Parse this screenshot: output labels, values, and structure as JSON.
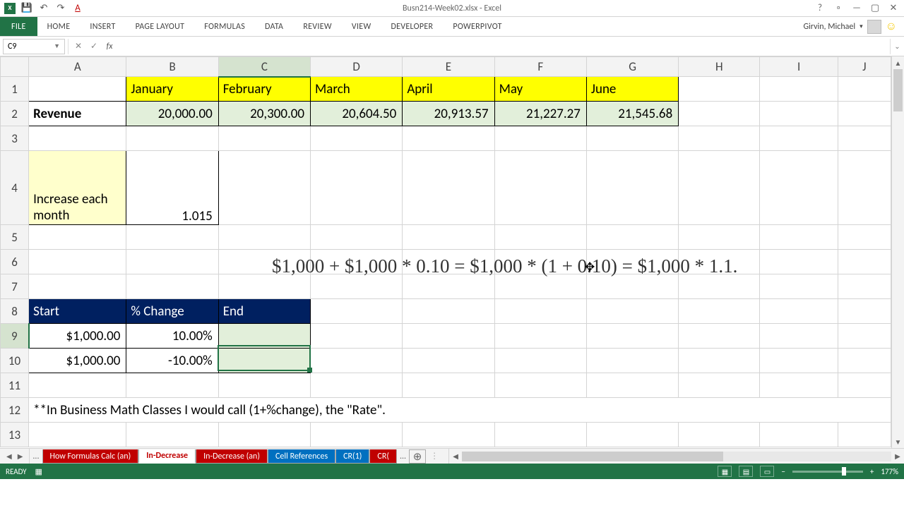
{
  "titlebar": {
    "filename": "Busn214-Week02.xlsx - Excel",
    "qat_icons": [
      "excel",
      "save",
      "undo",
      "redo",
      "font-color"
    ]
  },
  "ribbon": {
    "tabs": [
      "FILE",
      "HOME",
      "INSERT",
      "PAGE LAYOUT",
      "FORMULAS",
      "DATA",
      "REVIEW",
      "VIEW",
      "DEVELOPER",
      "POWERPIVOT"
    ],
    "user": "Girvin, Michael"
  },
  "namebox": {
    "value": "C9"
  },
  "formulabar": {
    "value": ""
  },
  "columns": [
    "A",
    "B",
    "C",
    "D",
    "E",
    "F",
    "G",
    "H",
    "I",
    "J"
  ],
  "active_col": "C",
  "active_row": "9",
  "rows_visible": [
    "1",
    "2",
    "3",
    "4",
    "5",
    "6",
    "7",
    "8",
    "9",
    "10",
    "11",
    "12",
    "13"
  ],
  "cells": {
    "A2": "Revenue",
    "B1": "January",
    "C1": "February",
    "D1": "March",
    "E1": "April",
    "F1": "May",
    "G1": "June",
    "B2": "20,000.00",
    "C2": "20,300.00",
    "D2": "20,604.50",
    "E2": "20,913.57",
    "F2": "21,227.27",
    "G2": "21,545.68",
    "A4": "Increase each month",
    "B4": "1.015",
    "A8": "Start",
    "B8": "% Change",
    "C8": "End",
    "A9": "$1,000.00",
    "B9": "10.00%",
    "A10": "$1,000.00",
    "B10": "-10.00%",
    "A12": "**In Business Math Classes I would call (1+%change), the \"Rate\"."
  },
  "floating_formula": "$1,000 + $1,000 * 0.10 = $1,000 * (1 + 0.10) = $1,000 * 1.1.",
  "sheet_tabs": {
    "nav_dots": "...",
    "tabs": [
      {
        "label": "How Formulas Calc (an)",
        "style": "red"
      },
      {
        "label": "In-Decrease",
        "style": "active"
      },
      {
        "label": "In-Decrease (an)",
        "style": "red"
      },
      {
        "label": "Cell References",
        "style": "blue"
      },
      {
        "label": "CR(1)",
        "style": "blue"
      },
      {
        "label": "CR(",
        "style": "red"
      }
    ],
    "nav_dots2": "..."
  },
  "statusbar": {
    "mode": "READY",
    "zoom": "177%"
  },
  "chart_data": {
    "type": "table",
    "title": "Revenue by month with 1.5% increase",
    "categories": [
      "January",
      "February",
      "March",
      "April",
      "May",
      "June"
    ],
    "values": [
      20000.0,
      20300.0,
      20604.5,
      20913.57,
      21227.27,
      21545.68
    ],
    "increase_factor": 1.015,
    "example": {
      "start": [
        1000.0,
        1000.0
      ],
      "pct_change": [
        0.1,
        -0.1
      ]
    },
    "note": "**In Business Math Classes I would call (1+%change), the \"Rate\"."
  }
}
